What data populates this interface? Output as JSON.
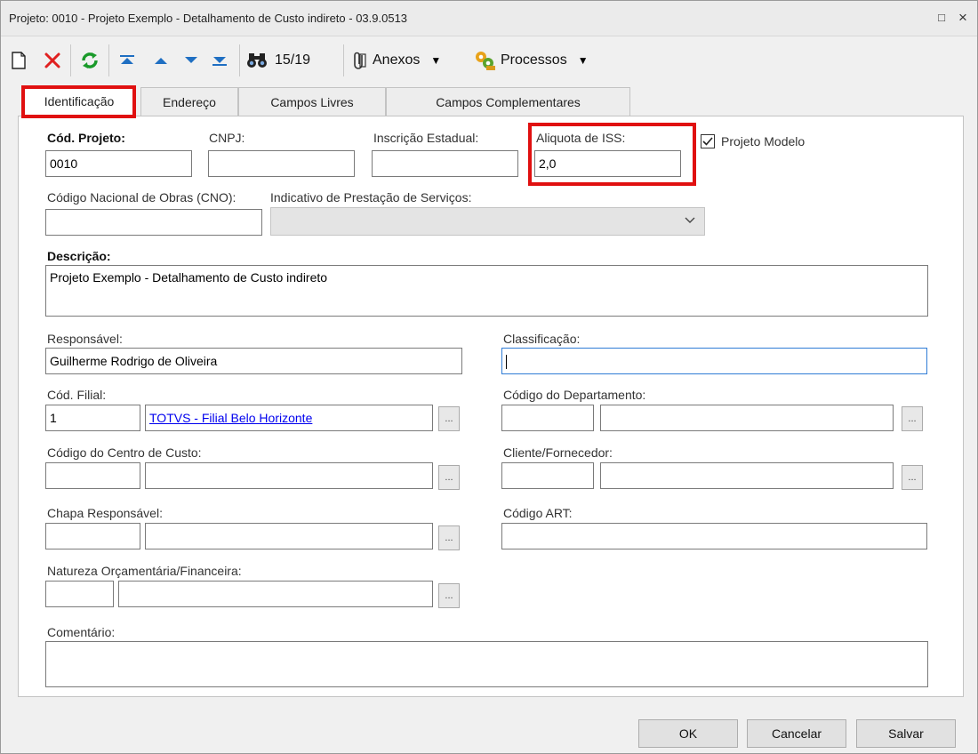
{
  "window": {
    "title": "Projeto: 0010 - Projeto Exemplo - Detalhamento de Custo indireto - 03.9.0513",
    "controls": {
      "maximize": "□",
      "close": "×"
    }
  },
  "toolbar": {
    "record_position": "15/19",
    "anexos_label": "Anexos",
    "processos_label": "Processos",
    "dropdown_glyph": "▼"
  },
  "tabs": [
    {
      "label": "Identificação",
      "active": true
    },
    {
      "label": "Endereço"
    },
    {
      "label": "Campos Livres"
    },
    {
      "label": "Campos Complementares"
    }
  ],
  "form": {
    "cod_projeto": {
      "label": "Cód. Projeto:",
      "value": "0010"
    },
    "cnpj": {
      "label": "CNPJ:",
      "value": ""
    },
    "inscricao_estadual": {
      "label": "Inscrição Estadual:",
      "value": ""
    },
    "aliquota_iss": {
      "label": "Aliquota de ISS:",
      "value": "2,0"
    },
    "projeto_modelo": {
      "label": "Projeto Modelo",
      "checked": true
    },
    "cno": {
      "label": "Código Nacional de Obras (CNO):",
      "value": ""
    },
    "indicativo": {
      "label": "Indicativo de Prestação de Serviços:",
      "value": ""
    },
    "descricao": {
      "label": "Descrição:",
      "value": "Projeto Exemplo - Detalhamento de Custo indireto"
    },
    "responsavel": {
      "label": "Responsável:",
      "value": "Guilherme Rodrigo de Oliveira"
    },
    "classificacao": {
      "label": "Classificação:",
      "value": ""
    },
    "cod_filial": {
      "label": "Cód. Filial:",
      "code": "1",
      "name": "TOTVS - Filial Belo Horizonte"
    },
    "cod_departamento": {
      "label": "Código do Departamento:",
      "code": "",
      "name": ""
    },
    "centro_custo": {
      "label": "Código do Centro de Custo:",
      "code": "",
      "name": ""
    },
    "cliente_fornecedor": {
      "label": "Cliente/Fornecedor:",
      "code": "",
      "name": ""
    },
    "chapa_responsavel": {
      "label": "Chapa Responsável:",
      "code": "",
      "name": ""
    },
    "codigo_art": {
      "label": "Código ART:",
      "value": ""
    },
    "natureza": {
      "label": "Natureza Orçamentária/Financeira:",
      "code": "",
      "name": ""
    },
    "comentario": {
      "label": "Comentário:",
      "value": ""
    },
    "lookup_glyph": "..."
  },
  "buttons": {
    "ok": "OK",
    "cancelar": "Cancelar",
    "salvar": "Salvar"
  },
  "colors": {
    "highlight": "#e01010",
    "link": "#0000ee",
    "focus": "#2f7cd6"
  }
}
